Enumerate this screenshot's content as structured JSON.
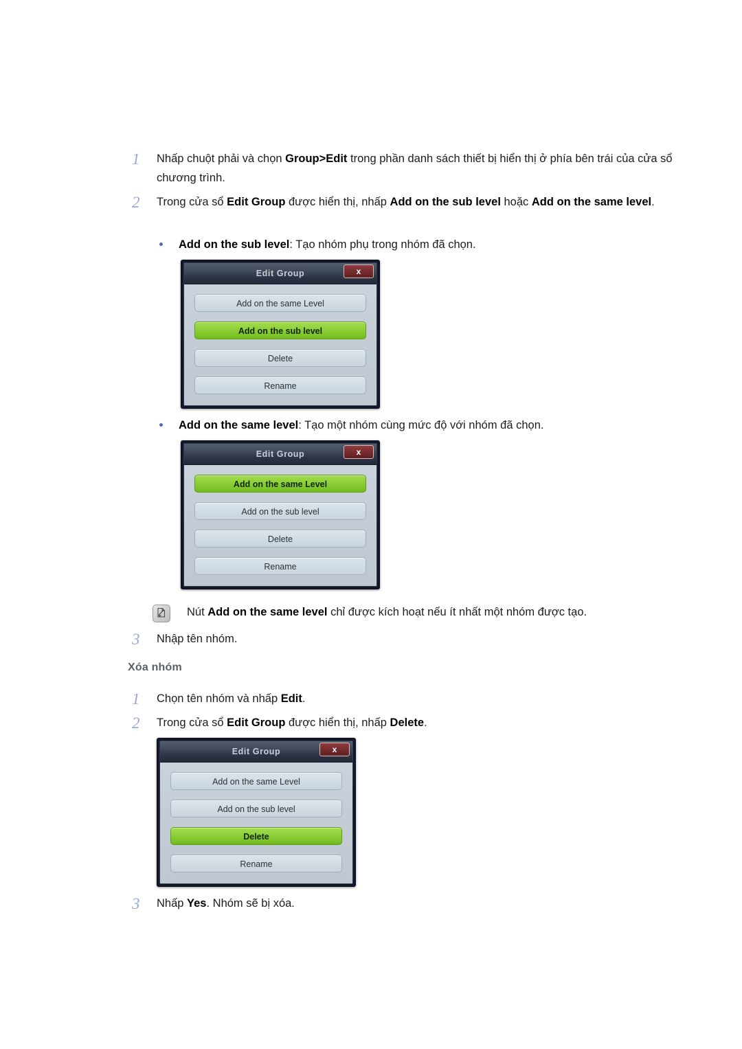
{
  "steps_create": [
    {
      "num": "1",
      "parts": [
        {
          "t": "Nhấp chuột phải và chọn ",
          "b": false
        },
        {
          "t": "Group>Edit",
          "b": true
        },
        {
          "t": " trong phần danh sách thiết bị hiển thị ở phía bên trái của cửa sổ chương trình.",
          "b": false
        }
      ]
    },
    {
      "num": "2",
      "parts": [
        {
          "t": "Trong cửa sổ ",
          "b": false
        },
        {
          "t": "Edit Group",
          "b": true
        },
        {
          "t": " được hiển thị, nhấp ",
          "b": false
        },
        {
          "t": "Add on the sub level",
          "b": true
        },
        {
          "t": " hoặc ",
          "b": false
        },
        {
          "t": "Add on the same level",
          "b": true
        },
        {
          "t": ".",
          "b": false
        }
      ]
    },
    {
      "num": "3",
      "parts": [
        {
          "t": "Nhập tên nhóm.",
          "b": false
        }
      ]
    }
  ],
  "bullets": [
    {
      "parts": [
        {
          "t": "Add on the sub level",
          "b": true
        },
        {
          "t": ": Tạo nhóm phụ trong nhóm đã chọn.",
          "b": false
        }
      ]
    },
    {
      "parts": [
        {
          "t": "Add on the same level",
          "b": true
        },
        {
          "t": ": Tạo một nhóm cùng mức độ với nhóm đã chọn.",
          "b": false
        }
      ]
    }
  ],
  "note": {
    "icon": "note-pencil-icon",
    "parts": [
      {
        "t": "Nút ",
        "b": false
      },
      {
        "t": "Add on the same level",
        "b": true
      },
      {
        "t": " chỉ được kích hoạt nếu ít nhất một nhóm được tạo.",
        "b": false
      }
    ]
  },
  "section_heading": "Xóa nhóm",
  "steps_delete": [
    {
      "num": "1",
      "parts": [
        {
          "t": "Chọn tên nhóm và nhấp ",
          "b": false
        },
        {
          "t": "Edit",
          "b": true
        },
        {
          "t": ".",
          "b": false
        }
      ]
    },
    {
      "num": "2",
      "parts": [
        {
          "t": "Trong cửa sổ ",
          "b": false
        },
        {
          "t": "Edit Group",
          "b": true
        },
        {
          "t": " được hiển thị, nhấp ",
          "b": false
        },
        {
          "t": "Delete",
          "b": true
        },
        {
          "t": ".",
          "b": false
        }
      ]
    },
    {
      "num": "3",
      "parts": [
        {
          "t": "Nhấp ",
          "b": false
        },
        {
          "t": "Yes",
          "b": true
        },
        {
          "t": ". Nhóm sẽ bị xóa.",
          "b": false
        }
      ]
    }
  ],
  "dialogs": [
    {
      "title": "Edit Group",
      "close_label": "x",
      "close_icon": "close-icon",
      "buttons": [
        {
          "label": "Add on the same Level",
          "selected": false
        },
        {
          "label": "Add on the sub level",
          "selected": true
        },
        {
          "label": "Delete",
          "selected": false
        },
        {
          "label": "Rename",
          "selected": false
        }
      ]
    },
    {
      "title": "Edit Group",
      "close_label": "x",
      "close_icon": "close-icon",
      "buttons": [
        {
          "label": "Add on the same Level",
          "selected": true
        },
        {
          "label": "Add on the sub level",
          "selected": false
        },
        {
          "label": "Delete",
          "selected": false
        },
        {
          "label": "Rename",
          "selected": false
        }
      ]
    },
    {
      "title": "Edit Group",
      "close_label": "x",
      "close_icon": "close-icon",
      "buttons": [
        {
          "label": "Add on the same Level",
          "selected": false
        },
        {
          "label": "Add on the sub level",
          "selected": false
        },
        {
          "label": "Delete",
          "selected": true
        },
        {
          "label": "Rename",
          "selected": false
        }
      ]
    }
  ],
  "colors": {
    "step_number": "#9aa6dd",
    "bullet": "#4f6ab0",
    "heading": "#5b6066",
    "dialog_frame": "#12172a",
    "dialog_body": "#c4cdd5",
    "button": "#d2dce4",
    "button_selected": "#8ed03a",
    "close_button": "#7a2e31",
    "text": "#1c1c1c"
  }
}
